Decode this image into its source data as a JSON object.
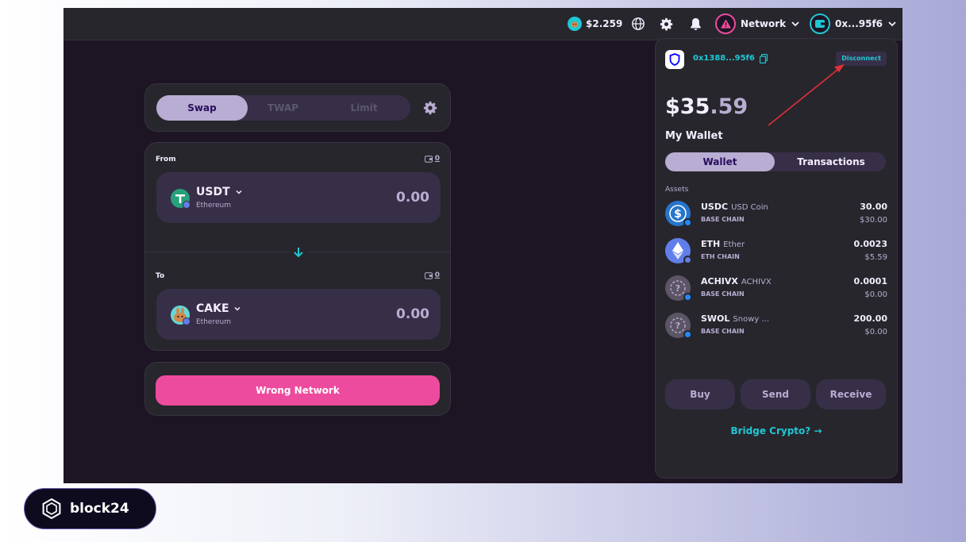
{
  "topbar": {
    "cake_price": "$2.259",
    "network_label": "Network",
    "account_label": "0x...95f6"
  },
  "swap": {
    "tabs": [
      {
        "label": "Swap",
        "active": true
      },
      {
        "label": "TWAP",
        "active": false
      },
      {
        "label": "Limit",
        "active": false
      }
    ],
    "from_label": "From",
    "from_balance": "0",
    "from_token": {
      "symbol": "USDT",
      "chain": "Ethereum",
      "amount": "0.00",
      "color": "#26a17b"
    },
    "to_label": "To",
    "to_balance": "0",
    "to_token": {
      "symbol": "CAKE",
      "chain": "Ethereum",
      "amount": "0.00",
      "color": "#62d9d8"
    },
    "action_button": "Wrong Network"
  },
  "wallet": {
    "address": "0x1388...95f6",
    "disconnect_label": "Disconnect",
    "balance_int": "$35",
    "balance_dec": ".59",
    "title": "My Wallet",
    "tabs": [
      {
        "label": "Wallet",
        "active": true
      },
      {
        "label": "Transactions",
        "active": false
      }
    ],
    "assets_label": "Assets",
    "assets": [
      {
        "symbol": "USDC",
        "name": "USD Coin",
        "chain": "BASE CHAIN",
        "amount": "30.00",
        "value": "$30.00",
        "icon": "usdc-icon",
        "color": "#2775ca"
      },
      {
        "symbol": "ETH",
        "name": "Ether",
        "chain": "ETH CHAIN",
        "amount": "0.0023",
        "value": "$5.59",
        "icon": "eth-icon",
        "color": "#627eea"
      },
      {
        "symbol": "ACHIVX",
        "name": "ACHIVX",
        "chain": "BASE CHAIN",
        "amount": "0.0001",
        "value": "$0.00",
        "icon": "unknown-token-icon",
        "color": "#6b6577"
      },
      {
        "symbol": "SWOL",
        "name": "Snowy ...",
        "chain": "BASE CHAIN",
        "amount": "200.00",
        "value": "$0.00",
        "icon": "unknown-token-icon",
        "color": "#6b6577"
      }
    ],
    "buttons": [
      "Buy",
      "Send",
      "Receive"
    ],
    "bridge_label": "Bridge Crypto?",
    "bridge_arrow": "→"
  },
  "branding": {
    "logo_text": "block24"
  },
  "colors": {
    "background": "#1d1524",
    "card": "#27262c",
    "accent": "#1fc7d4",
    "primary_pink": "#ed4b9e",
    "active_tab": "#b8add2",
    "warning": "#ed4b9e"
  }
}
